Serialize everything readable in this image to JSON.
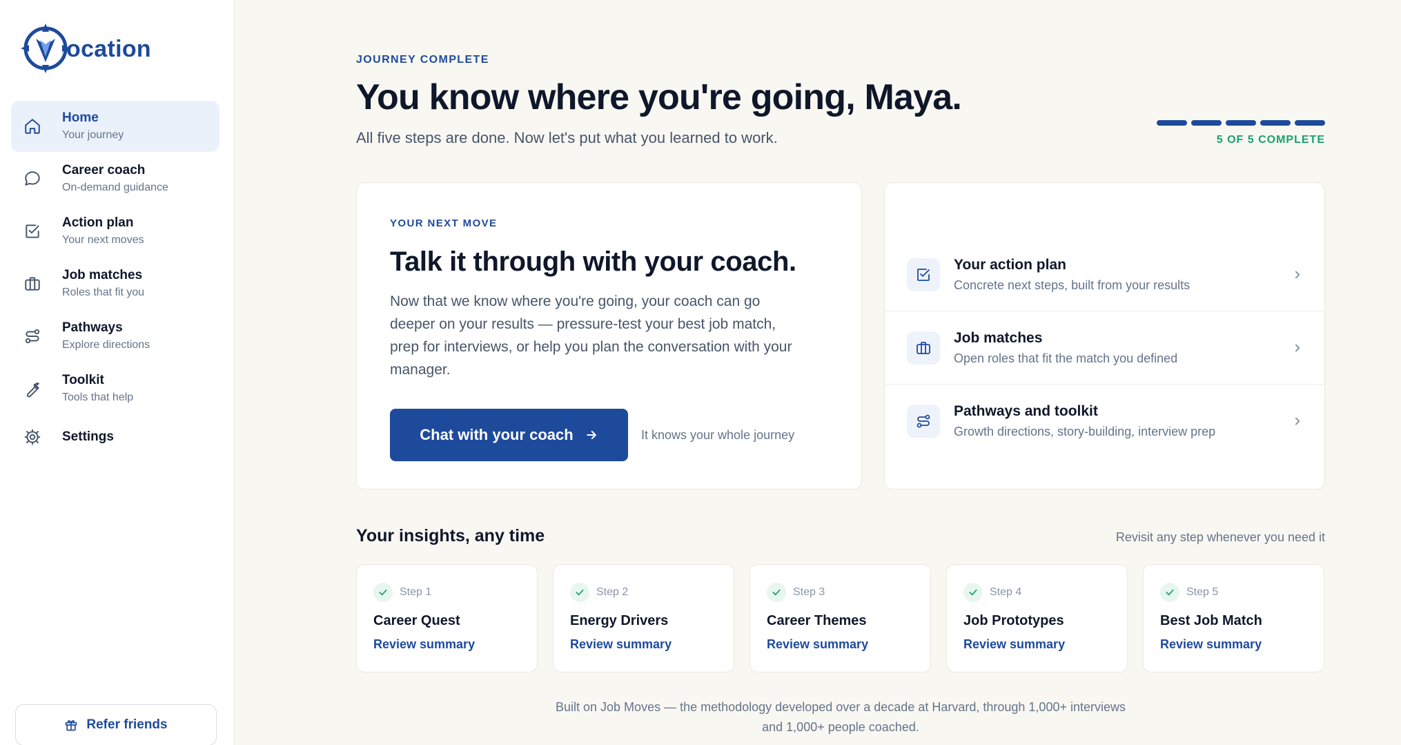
{
  "brand": {
    "name": "ocation",
    "accent": "#1e4a9c",
    "success": "#16a36a",
    "background": "#f9f7f2"
  },
  "sidebar": {
    "items": [
      {
        "label": "Home",
        "sub": "Your journey",
        "icon": "home-icon"
      },
      {
        "label": "Career coach",
        "sub": "On-demand guidance",
        "icon": "chat-bubble-icon"
      },
      {
        "label": "Action plan",
        "sub": "Your next moves",
        "icon": "checkbox-icon"
      },
      {
        "label": "Job matches",
        "sub": "Roles that fit you",
        "icon": "briefcase-icon"
      },
      {
        "label": "Pathways",
        "sub": "Explore directions",
        "icon": "route-icon"
      },
      {
        "label": "Toolkit",
        "sub": "Tools that help",
        "icon": "wrench-icon"
      },
      {
        "label": "Settings",
        "icon": "gear-icon"
      }
    ],
    "refer_label": "Refer friends"
  },
  "hero": {
    "eyebrow": "JOURNEY COMPLETE",
    "title": "You know where you're going, Maya.",
    "subtitle": "All five steps are done. Now let's put what you learned to work.",
    "progress_completed": 5,
    "progress_total": 5,
    "progress_label": "5 OF 5 COMPLETE"
  },
  "next_move": {
    "eyebrow": "YOUR NEXT MOVE",
    "title": "Talk it through with your coach.",
    "body": "Now that we know where you're going, your coach can go deeper on your results — pressure-test your best job match, prep for interviews, or help you plan the conversation with your manager.",
    "button_label": "Chat with your coach",
    "note": "It knows your whole journey"
  },
  "links": [
    {
      "title": "Your action plan",
      "sub": "Concrete next steps, built from your results",
      "icon": "checkbox-icon"
    },
    {
      "title": "Job matches",
      "sub": "Open roles that fit the match you defined",
      "icon": "briefcase-icon"
    },
    {
      "title": "Pathways and toolkit",
      "sub": "Growth directions, story-building, interview prep",
      "icon": "route-icon"
    }
  ],
  "insights": {
    "title": "Your insights, any time",
    "note": "Revisit any step whenever you need it",
    "steps": [
      {
        "num": "Step 1",
        "name": "Career Quest",
        "link": "Review summary"
      },
      {
        "num": "Step 2",
        "name": "Energy Drivers",
        "link": "Review summary"
      },
      {
        "num": "Step 3",
        "name": "Career Themes",
        "link": "Review summary"
      },
      {
        "num": "Step 4",
        "name": "Job Prototypes",
        "link": "Review summary"
      },
      {
        "num": "Step 5",
        "name": "Best Job Match",
        "link": "Review summary"
      }
    ]
  },
  "footer": {
    "line1": "Built on Job Moves — the methodology developed over a decade at Harvard, through 1,000+ interviews",
    "line2": "and 1,000+ people coached."
  }
}
